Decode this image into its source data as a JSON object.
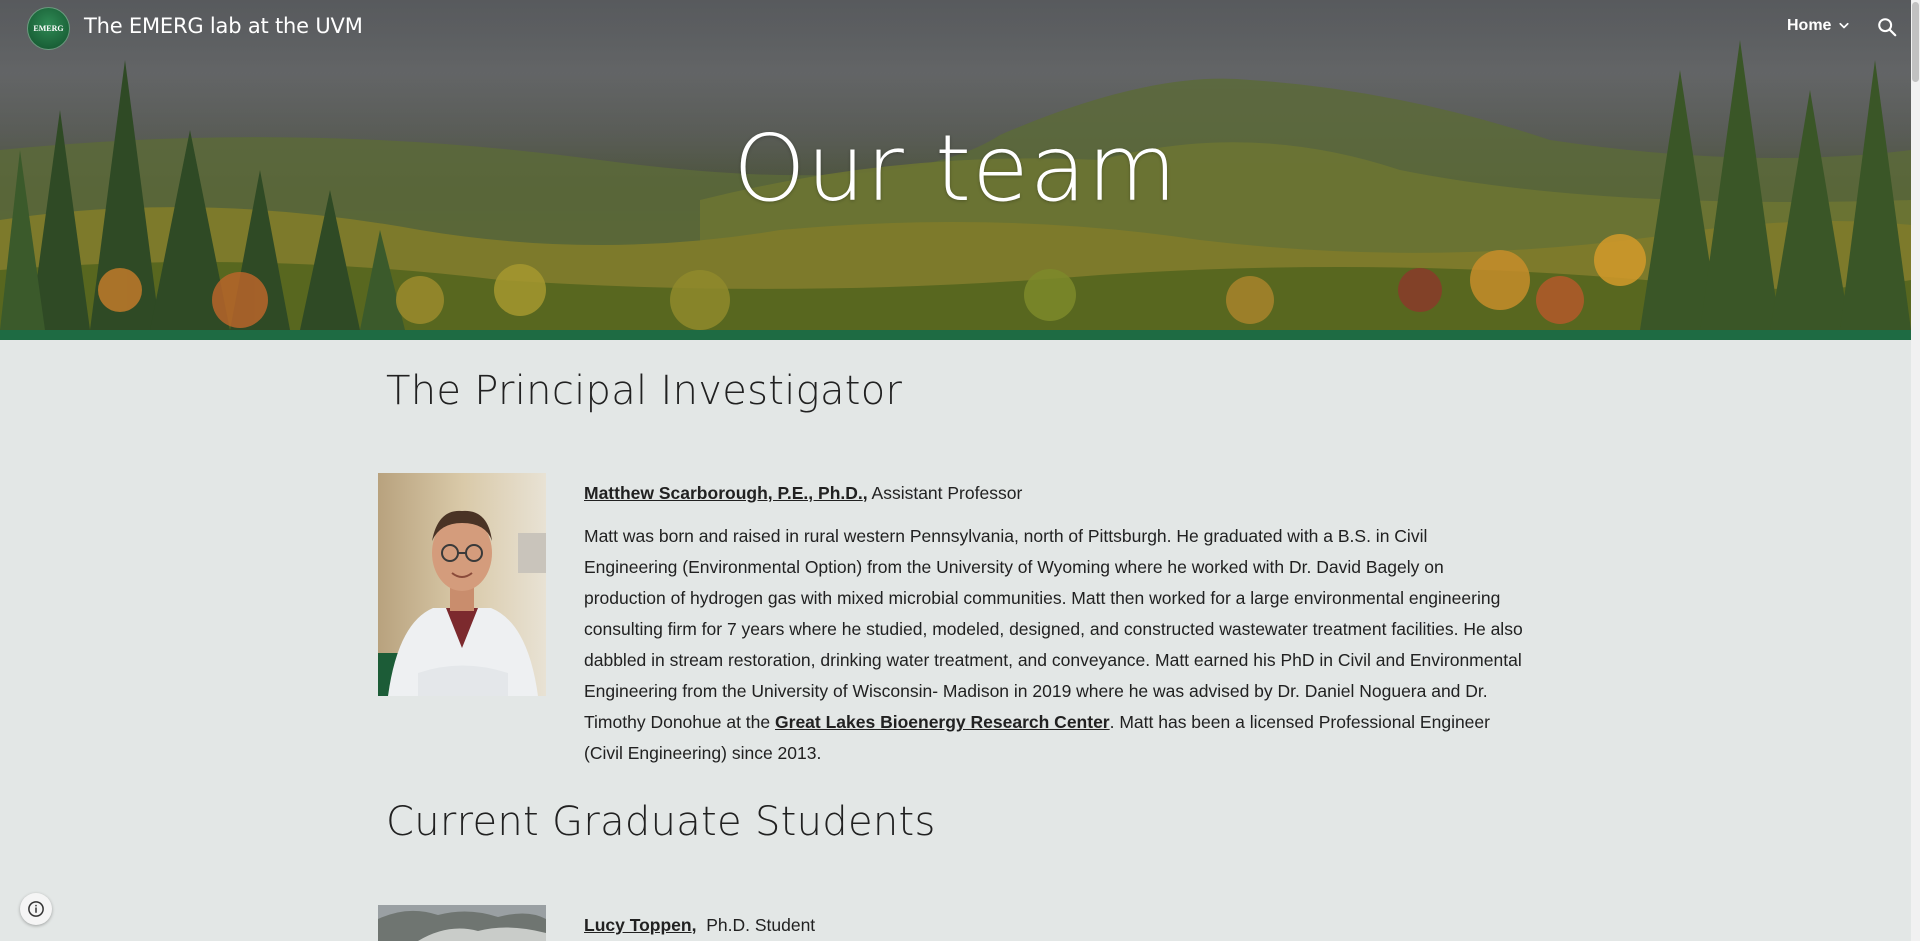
{
  "header": {
    "logo_text": "EMERG",
    "site_title": "The EMERG lab at the UVM",
    "nav_home": "Home",
    "icons": [
      "chevron-down-icon",
      "search-icon"
    ]
  },
  "hero": {
    "title": "Our team"
  },
  "colors": {
    "accent_bar": "#1e6b43",
    "page_background": "#e3e7e6"
  },
  "pi_section": {
    "heading": "The Principal Investigator",
    "name": "Matthew Scarborough, P.E., Ph.D.",
    "name_sep": ",",
    "title": " Assistant Professor",
    "bio_part1": "Matt was born and raised in rural western Pennsylvania, north of Pittsburgh. He graduated with a B.S. in Civil Engineering (Environmental Option) from the University of Wyoming where he worked with Dr. David Bagely on production of hydrogen gas with mixed microbial communities. Matt then worked for a large environmental engineering consulting firm for 7 years where he studied, modeled, designed, and constructed wastewater treatment facilities. He also dabbled in stream restoration, drinking water treatment, and conveyance. Matt earned his PhD in Civil and Environmental Engineering from the University of Wisconsin- Madison in 2019 where he was advised by Dr. Daniel Noguera and Dr. Timothy Donohue at the",
    "bio_link": "Great Lakes Bioenergy Research Center",
    "bio_part2": ". Matt has been a licensed Professional Engineer (Civil Engineering) since 2013."
  },
  "grad_section": {
    "heading": "Current Graduate Students",
    "students": [
      {
        "name": "Lucy Toppen",
        "sep": ",",
        "role": "Ph.D. Student"
      }
    ]
  },
  "footer": {
    "info_icon": "info-icon"
  }
}
